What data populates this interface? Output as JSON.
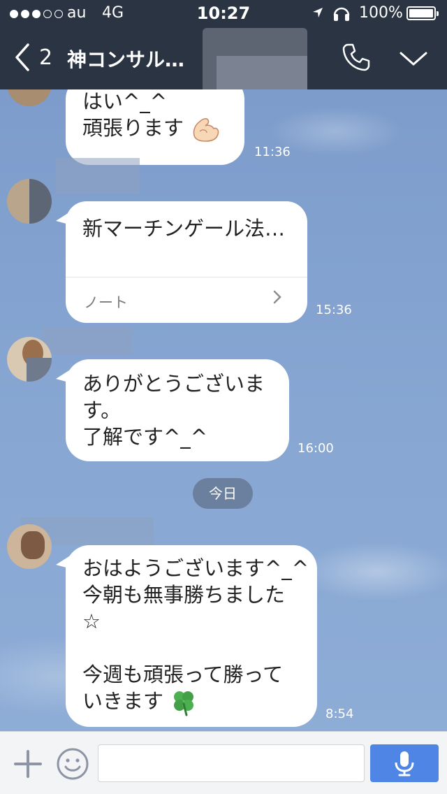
{
  "status_bar": {
    "carrier": "au",
    "network": "4G",
    "time": "10:27",
    "battery": "100%",
    "signal_filled": 3,
    "signal_total": 5
  },
  "header": {
    "back_count": "2",
    "title": "神コンサル…"
  },
  "messages": [
    {
      "lines": [
        "はい^_^",
        "頑張ります"
      ],
      "emoji": "flexed-biceps",
      "time": "11:36"
    },
    {
      "lines": [
        "新マーチンゲール法…"
      ],
      "note_label": "ノート",
      "time": "15:36"
    },
    {
      "lines": [
        "ありがとうございま",
        "す。",
        "了解です^_^"
      ],
      "time": "16:00"
    },
    {
      "lines": [
        "おはようございます^_^",
        "今朝も無事勝ちました",
        "☆",
        "",
        "今週も頑張って勝って",
        "いきます"
      ],
      "emoji": "four-leaf-clover",
      "time": "8:54"
    }
  ],
  "day_divider": "今日",
  "input": {
    "placeholder": ""
  },
  "colors": {
    "header_bg": "#2b3443",
    "send_button": "#4f85e4",
    "bubble": "#ffffff"
  }
}
